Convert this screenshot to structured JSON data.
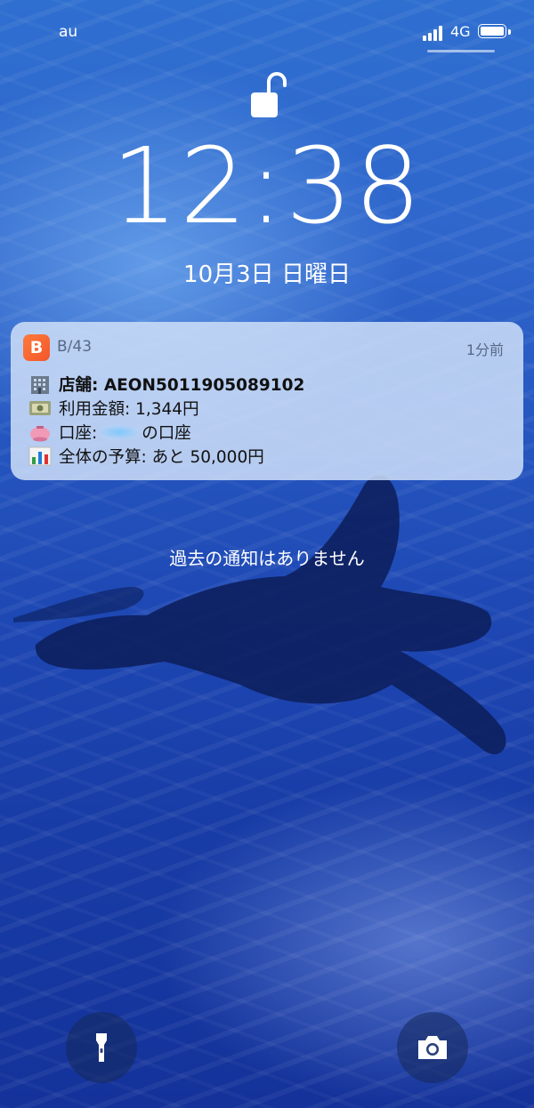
{
  "status_bar": {
    "carrier": "au",
    "network": "4G"
  },
  "lock_screen": {
    "time": "12:38",
    "date": "10月3日 日曜日",
    "no_older_notifications": "過去の通知はありません"
  },
  "notification": {
    "app_icon_letter": "B",
    "app_name": "B/43",
    "time_ago": "1分前",
    "store_line": "店舗: AEON5011905089102",
    "amount_line": "利用金額: 1,344円",
    "account_prefix": "口座: ",
    "account_suffix": "の口座",
    "budget_line": "全体の予算: あと 50,000円",
    "icons": [
      "building-emoji-icon",
      "money-emoji-icon",
      "piggy-bank-emoji-icon",
      "bar-chart-emoji-icon"
    ],
    "accent_color": "#f2572a"
  },
  "bottom_controls": {
    "left_icon": "flashlight-icon",
    "right_icon": "camera-icon"
  }
}
